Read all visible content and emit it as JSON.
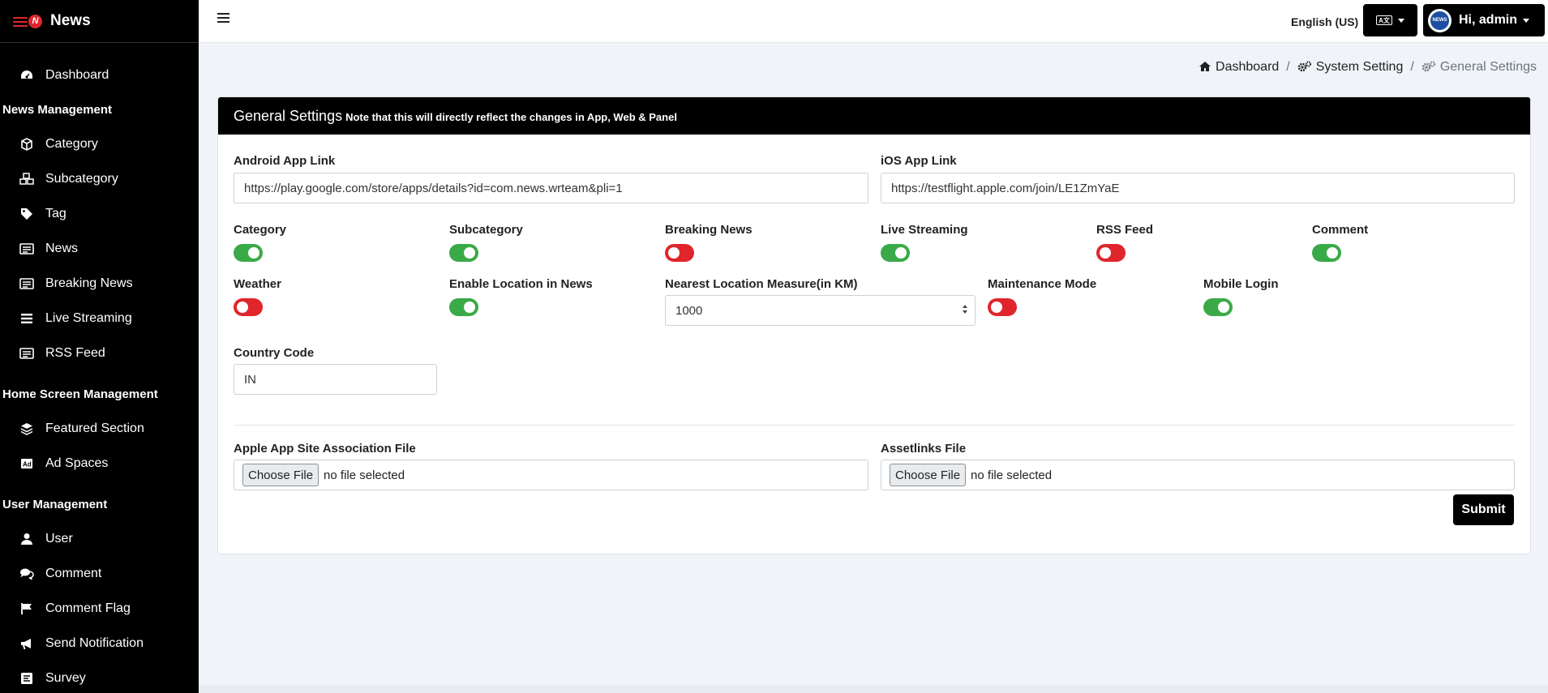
{
  "brand": {
    "name": "News"
  },
  "sidebar": {
    "top": [
      {
        "label": "Dashboard",
        "icon": "dashboard-icon"
      }
    ],
    "sections": [
      {
        "header": "News Management",
        "items": [
          {
            "label": "Category",
            "icon": "cube-icon"
          },
          {
            "label": "Subcategory",
            "icon": "cubes-icon"
          },
          {
            "label": "Tag",
            "icon": "tag-icon"
          },
          {
            "label": "News",
            "icon": "newspaper-icon"
          },
          {
            "label": "Breaking News",
            "icon": "newspaper-icon"
          },
          {
            "label": "Live Streaming",
            "icon": "bars-icon"
          },
          {
            "label": "RSS Feed",
            "icon": "newspaper-icon"
          }
        ]
      },
      {
        "header": "Home Screen Management",
        "items": [
          {
            "label": "Featured Section",
            "icon": "layers-icon"
          },
          {
            "label": "Ad Spaces",
            "icon": "ad-icon"
          }
        ]
      },
      {
        "header": "User Management",
        "items": [
          {
            "label": "User",
            "icon": "user-icon"
          },
          {
            "label": "Comment",
            "icon": "comments-icon"
          },
          {
            "label": "Comment Flag",
            "icon": "flag-icon"
          },
          {
            "label": "Send Notification",
            "icon": "bullhorn-icon"
          },
          {
            "label": "Survey",
            "icon": "poll-icon"
          }
        ]
      }
    ]
  },
  "topbar": {
    "language": "English (US)",
    "user_greeting": "Hi, admin",
    "avatar_text": "NEWS"
  },
  "breadcrumb": {
    "items": [
      "Dashboard",
      "System Setting",
      "General Settings"
    ],
    "separator": "/"
  },
  "card": {
    "title": "General Settings",
    "note": "Note that this will directly reflect the changes in App, Web & Panel"
  },
  "fields": {
    "android_label": "Android App Link",
    "android_value": "https://play.google.com/store/apps/details?id=com.news.wrteam&pli=1",
    "ios_label": "iOS App Link",
    "ios_value": "https://testflight.apple.com/join/LE1ZmYaE",
    "nearest_label": "Nearest Location Measure(in KM)",
    "nearest_value": "1000",
    "country_label": "Country Code",
    "country_value": "IN",
    "apple_file_label": "Apple App Site Association File",
    "assetlinks_label": "Assetlinks File",
    "choose_file": "Choose File",
    "no_file": "no file selected"
  },
  "toggles": [
    {
      "label": "Category",
      "on": true
    },
    {
      "label": "Subcategory",
      "on": true
    },
    {
      "label": "Breaking News",
      "on": false
    },
    {
      "label": "Live Streaming",
      "on": true
    },
    {
      "label": "RSS Feed",
      "on": false
    },
    {
      "label": "Comment",
      "on": true
    },
    {
      "label": "Weather",
      "on": false
    },
    {
      "label": "Enable Location in News",
      "on": true
    },
    {
      "label": "Maintenance Mode",
      "on": false
    },
    {
      "label": "Mobile Login",
      "on": true
    }
  ],
  "submit_label": "Submit",
  "colors": {
    "on": "#3aaa48",
    "off": "#e0262b",
    "header": "#000000"
  }
}
